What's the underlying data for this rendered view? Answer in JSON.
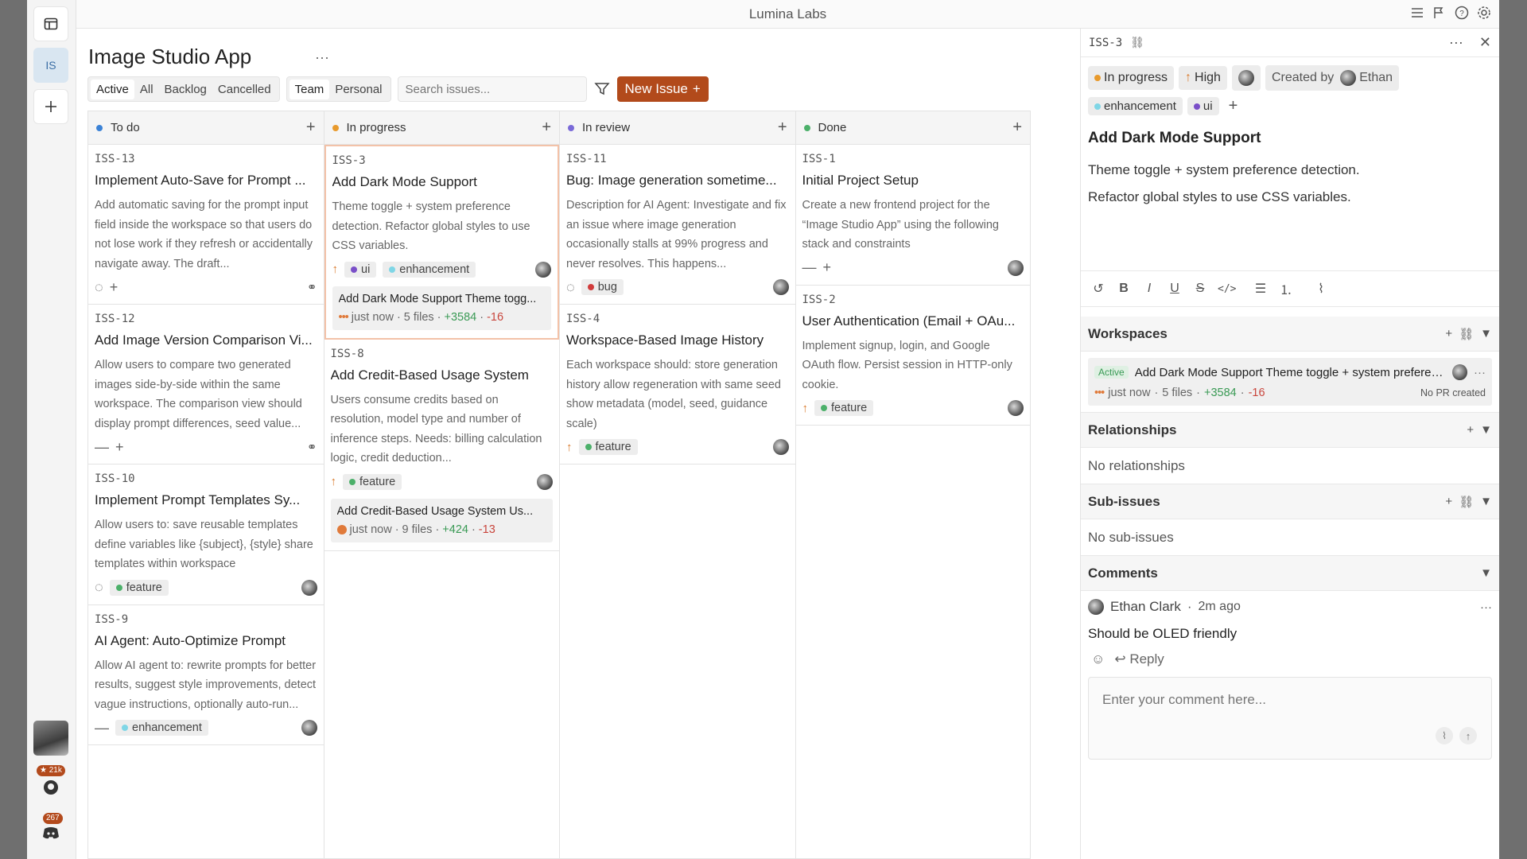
{
  "app_title": "Lumina Labs",
  "rail": {
    "project_abbr": "IS",
    "github_stars": "21k",
    "discord_count": "267"
  },
  "project": {
    "title": "Image Studio App",
    "more": "···"
  },
  "filters": {
    "status": [
      "Active",
      "All",
      "Backlog",
      "Cancelled"
    ],
    "scope": [
      "Team",
      "Personal"
    ],
    "search_placeholder": "Search issues...",
    "new_issue": "New Issue"
  },
  "columns": [
    {
      "name": "To do",
      "color": "#3b82d6"
    },
    {
      "name": "In progress",
      "color": "#e89a2c"
    },
    {
      "name": "In review",
      "color": "#7a6ad8"
    },
    {
      "name": "Done",
      "color": "#4cb06a"
    }
  ],
  "cards": {
    "todo": [
      {
        "id": "ISS-13",
        "title": "Implement Auto-Save for Prompt ...",
        "desc": "Add automatic saving for the prompt input field inside the workspace so that users do not lose work if they refresh or accidentally navigate away. The draft..."
      },
      {
        "id": "ISS-12",
        "title": "Add Image Version Comparison Vi...",
        "desc": "Allow users to compare two generated images side-by-side within the same workspace. The comparison view should display prompt differences, seed value..."
      },
      {
        "id": "ISS-10",
        "title": "Implement Prompt Templates Sy...",
        "desc": "Allow users to: save reusable templates define variables like {subject}, {style} share templates within workspace",
        "tag": "feature"
      },
      {
        "id": "ISS-9",
        "title": "AI Agent: Auto-Optimize Prompt",
        "desc": "Allow AI agent to: rewrite prompts for better results, suggest style improvements, detect vague instructions, optionally auto-run...",
        "tag": "enhancement"
      }
    ],
    "progress": [
      {
        "id": "ISS-3",
        "title": "Add Dark Mode Support",
        "desc": "Theme toggle + system preference detection. Refactor global styles to use CSS variables.",
        "tags": [
          "ui",
          "enhancement"
        ],
        "sub": {
          "title": "Add Dark Mode Support Theme togg...",
          "time": "just now",
          "files": "5 files",
          "add": "+3584",
          "del": "-16"
        }
      },
      {
        "id": "ISS-8",
        "title": "Add Credit-Based Usage System",
        "desc": "Users consume credits based on resolution, model type and number of inference steps. Needs: billing calculation logic, credit deduction...",
        "tag": "feature",
        "sub": {
          "title": "Add Credit-Based Usage System Us...",
          "time": "just now",
          "files": "9 files",
          "add": "+424",
          "del": "-13"
        }
      }
    ],
    "review": [
      {
        "id": "ISS-11",
        "title": "Bug: Image generation sometime...",
        "desc": "Description for AI Agent: Investigate and fix an issue where image generation occasionally stalls at 99% progress and never resolves. This happens...",
        "tag": "bug"
      },
      {
        "id": "ISS-4",
        "title": "Workspace-Based Image History",
        "desc": "Each workspace should: store generation history allow regeneration with same seed show metadata (model, seed, guidance scale)",
        "tag": "feature"
      }
    ],
    "done": [
      {
        "id": "ISS-1",
        "title": "Initial Project Setup",
        "desc": "Create a new frontend project for the “Image Studio App” using the following stack and constraints"
      },
      {
        "id": "ISS-2",
        "title": "User Authentication (Email + OAu...",
        "desc": "Implement signup, login, and Google OAuth flow. Persist session in HTTP-only cookie.",
        "tag": "feature"
      }
    ]
  },
  "panel": {
    "id": "ISS-3",
    "status": "In progress",
    "priority": "High",
    "created_by_label": "Created by",
    "created_by": "Ethan",
    "labels": [
      "enhancement",
      "ui"
    ],
    "title": "Add Dark Mode Support",
    "desc1": "Theme toggle + system preference detection.",
    "desc2": "Refactor global styles to use CSS variables.",
    "workspaces_label": "Workspaces",
    "ws": {
      "badge": "Active",
      "title": "Add Dark Mode Support Theme toggle + system preference...",
      "time": "just now",
      "files": "5 files",
      "add": "+3584",
      "del": "-16",
      "pr": "No PR created"
    },
    "relationships_label": "Relationships",
    "relationships_empty": "No relationships",
    "subissues_label": "Sub-issues",
    "subissues_empty": "No sub-issues",
    "comments_label": "Comments",
    "comment": {
      "author": "Ethan Clark",
      "time": "2m ago",
      "text": "Should be OLED friendly",
      "reply": "Reply"
    },
    "comment_placeholder": "Enter your comment here..."
  }
}
